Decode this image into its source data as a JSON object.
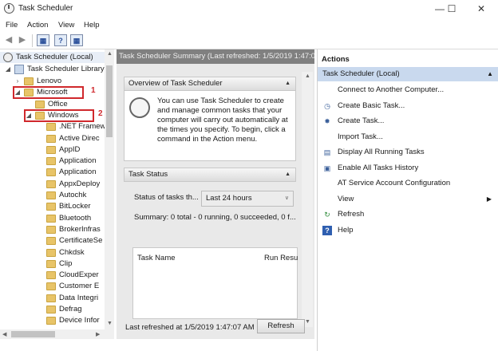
{
  "window": {
    "title": "Task Scheduler",
    "min": "—",
    "max": "☐",
    "close": "✕"
  },
  "menu": [
    "File",
    "Action",
    "View",
    "Help"
  ],
  "tree": {
    "root": "Task Scheduler (Local)",
    "library": "Task Scheduler Library",
    "items": [
      {
        "label": "Lenovo",
        "level": 2
      },
      {
        "label": "Microsoft",
        "level": 2,
        "expanded": true
      },
      {
        "label": "Office",
        "level": 3
      },
      {
        "label": "Windows",
        "level": 3,
        "expanded": true
      },
      {
        "label": ".NET Framew",
        "level": 4
      },
      {
        "label": "Active Direc",
        "level": 4
      },
      {
        "label": "AppID",
        "level": 4
      },
      {
        "label": "Application",
        "level": 4
      },
      {
        "label": "Application",
        "level": 4
      },
      {
        "label": "AppxDeploy",
        "level": 4
      },
      {
        "label": "Autochk",
        "level": 4
      },
      {
        "label": "BitLocker",
        "level": 4
      },
      {
        "label": "Bluetooth",
        "level": 4
      },
      {
        "label": "BrokerInfras",
        "level": 4
      },
      {
        "label": "CertificateSe",
        "level": 4
      },
      {
        "label": "Chkdsk",
        "level": 4
      },
      {
        "label": "Clip",
        "level": 4
      },
      {
        "label": "CloudExper",
        "level": 4
      },
      {
        "label": "Customer E",
        "level": 4
      },
      {
        "label": "Data Integri",
        "level": 4
      },
      {
        "label": "Defrag",
        "level": 4
      },
      {
        "label": "Device Infor",
        "level": 4
      }
    ],
    "annotation1": "1",
    "annotation2": "2"
  },
  "middle": {
    "header": "Task Scheduler Summary (Last refreshed: 1/5/2019 1:47:07",
    "overview_title": "Overview of Task Scheduler",
    "overview_text": "You can use Task Scheduler to create and manage common tasks that your computer will carry out automatically at the times you specify. To begin, click a command in the Action menu.",
    "status_title": "Task Status",
    "status_label": "Status of tasks th...",
    "status_range": "Last 24 hours",
    "summary": "Summary: 0 total - 0 running, 0 succeeded, 0 f...",
    "col_task_name": "Task Name",
    "col_run_result": "Run Resu",
    "last_refreshed": "Last refreshed at 1/5/2019 1:47:07 AM",
    "refresh_button": "Refresh"
  },
  "actions": {
    "header": "Actions",
    "selected": "Task Scheduler (Local)",
    "items": [
      {
        "label": "Connect to Another Computer...",
        "icon": ""
      },
      {
        "label": "Create Basic Task...",
        "icon": "create-basic-task-icon"
      },
      {
        "label": "Create Task...",
        "icon": "create-task-icon"
      },
      {
        "label": "Import Task...",
        "icon": ""
      },
      {
        "label": "Display All Running Tasks",
        "icon": "running-tasks-icon"
      },
      {
        "label": "Enable All Tasks History",
        "icon": "history-icon"
      },
      {
        "label": "AT Service Account Configuration",
        "icon": ""
      },
      {
        "label": "View",
        "icon": "",
        "submenu": true
      },
      {
        "label": "Refresh",
        "icon": "refresh-icon"
      },
      {
        "label": "Help",
        "icon": "help-icon"
      }
    ]
  },
  "colors": {
    "highlight": "#c9d9ee",
    "annotation": "#d0282c",
    "middle_header": "#808080"
  }
}
